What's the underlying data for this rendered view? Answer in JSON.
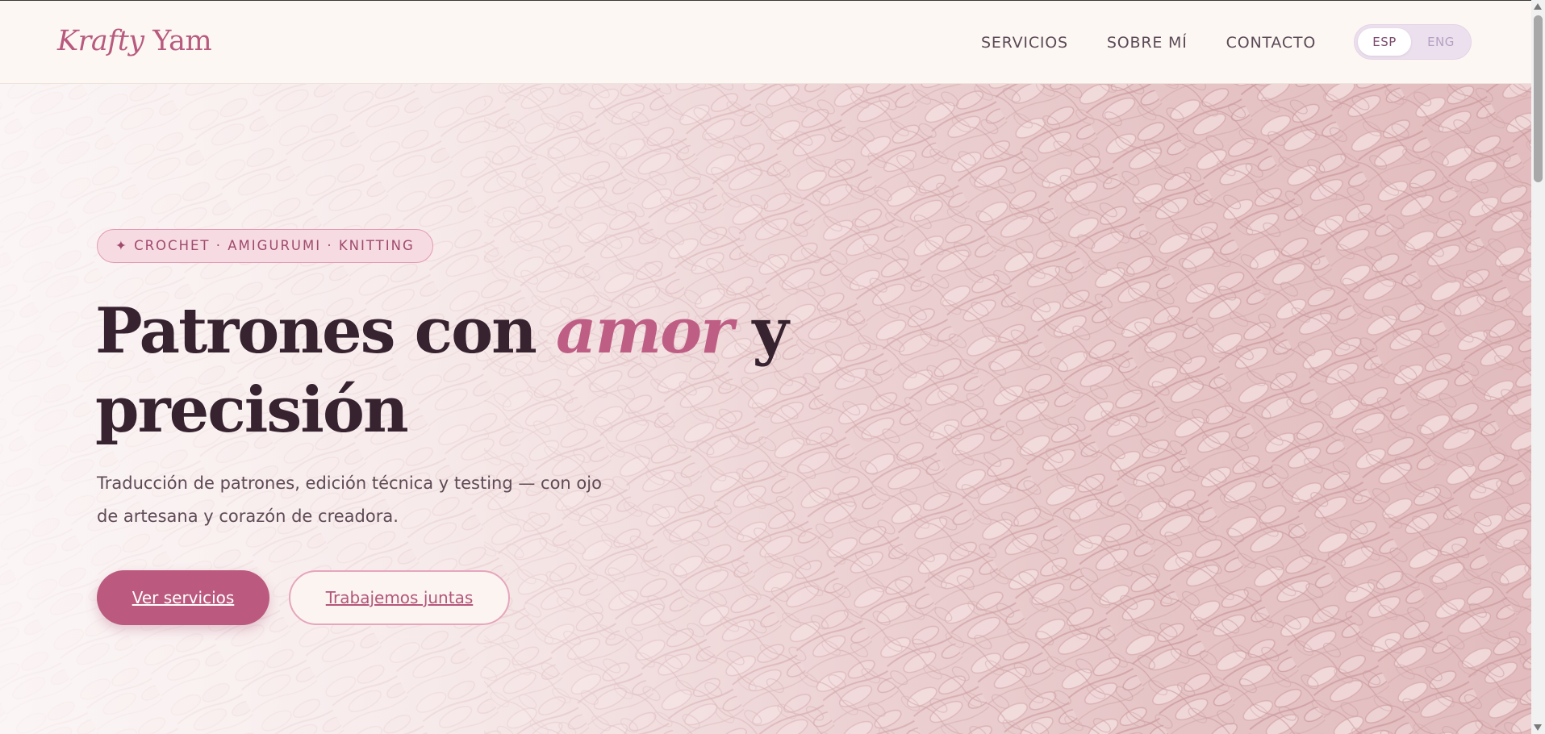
{
  "header": {
    "logo_italic": "Krafty",
    "logo_regular": "Yam",
    "nav": [
      "SERVICIOS",
      "SOBRE MÍ",
      "CONTACTO"
    ],
    "lang": {
      "active": "ESP",
      "inactive": "ENG"
    }
  },
  "hero": {
    "tag": "✦ CROCHET · AMIGURUMI · KNITTING",
    "title_part1": "Patrones con",
    "title_accent": "amor",
    "title_part2": "y",
    "title_line2": "precisión",
    "subtitle": "Traducción de patrones, edición técnica y testing — con ojo de artesana y corazón de creadora.",
    "cta_primary": "Ver servicios",
    "cta_secondary": "Trabajemos juntas"
  },
  "colors": {
    "accent": "#bb5a7e",
    "heading": "#37222f",
    "background": "#fdf8f5",
    "yarn": "#e8c9cb"
  }
}
